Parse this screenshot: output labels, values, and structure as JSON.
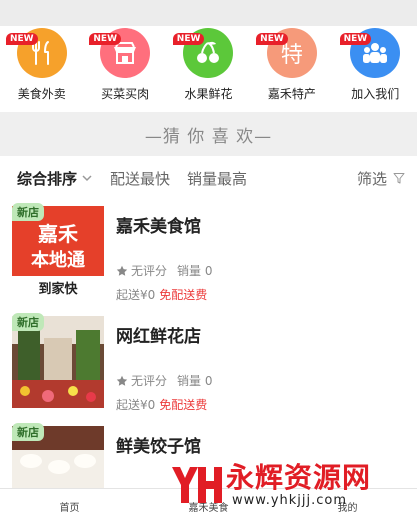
{
  "categories": [
    {
      "label": "美食外卖",
      "badge": "NEW",
      "icon": "fork-knife-icon",
      "color": "#f6a12b"
    },
    {
      "label": "买菜买肉",
      "badge": "NEW",
      "icon": "shop-icon",
      "color": "#ff6f7d"
    },
    {
      "label": "水果鲜花",
      "badge": "NEW",
      "icon": "cherry-icon",
      "color": "#5cc83a"
    },
    {
      "label": "嘉禾特产",
      "badge": "NEW",
      "icon": "te",
      "color": "#f69a7a"
    },
    {
      "label": "加入我们",
      "badge": "NEW",
      "icon": "people-icon",
      "color": "#3b8ff2"
    }
  ],
  "guess": {
    "text": "—猜 你 喜 欢—"
  },
  "filters": {
    "sort": "综合排序",
    "fastest": "配送最快",
    "sales": "销量最高",
    "screen": "筛选"
  },
  "shops": [
    {
      "badge": "新店",
      "name": "嘉禾美食馆",
      "rating": "无评分",
      "sales": "销量 0",
      "start": "起送¥0",
      "free": "免配送费",
      "thumb_text_1": "嘉禾",
      "thumb_text_2": "本地通",
      "thumb_text_3": "到家快"
    },
    {
      "badge": "新店",
      "name": "网红鲜花店",
      "rating": "无评分",
      "sales": "销量 0",
      "start": "起送¥0",
      "free": "免配送费"
    },
    {
      "badge": "新店",
      "name": "鲜美饺子馆"
    }
  ],
  "tabs": {
    "home": "首页",
    "food": "嘉禾美食",
    "mine": "我的"
  },
  "watermark": {
    "big": "永辉资源网",
    "small": "www.yhkjjj.com"
  },
  "colors": {
    "accent_red": "#e8202a",
    "free_red": "#ec3a3a",
    "badge_green": "#bfe8b8"
  }
}
